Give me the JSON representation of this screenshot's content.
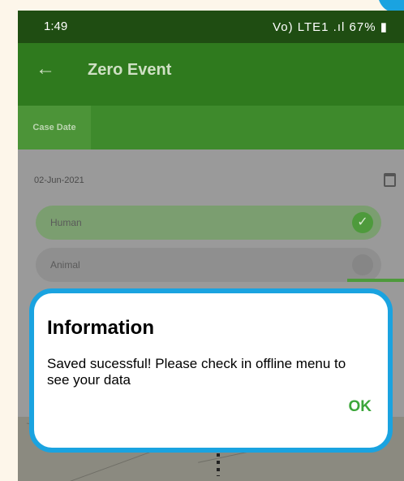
{
  "status_bar": {
    "time": "1:49",
    "icons_text": "Vo) LTE1 .ıl",
    "battery": "67%"
  },
  "app_bar": {
    "back_icon": "arrow-left-icon",
    "title": "Zero Event"
  },
  "tabs": [
    {
      "label": "Case Date"
    }
  ],
  "form": {
    "date": "02-Jun-2021",
    "calendar_icon": "calendar-icon",
    "options": [
      {
        "label": "Human",
        "selected": true
      },
      {
        "label": "Animal",
        "selected": false
      }
    ]
  },
  "dialog": {
    "title": "Information",
    "message": "Saved sucessful! Please check in offline menu to see your data",
    "ok_label": "OK"
  },
  "colors": {
    "dialog_border": "#1aa3e0",
    "ok_text": "#3ca63a",
    "app_bar": "#2f7a1e"
  }
}
